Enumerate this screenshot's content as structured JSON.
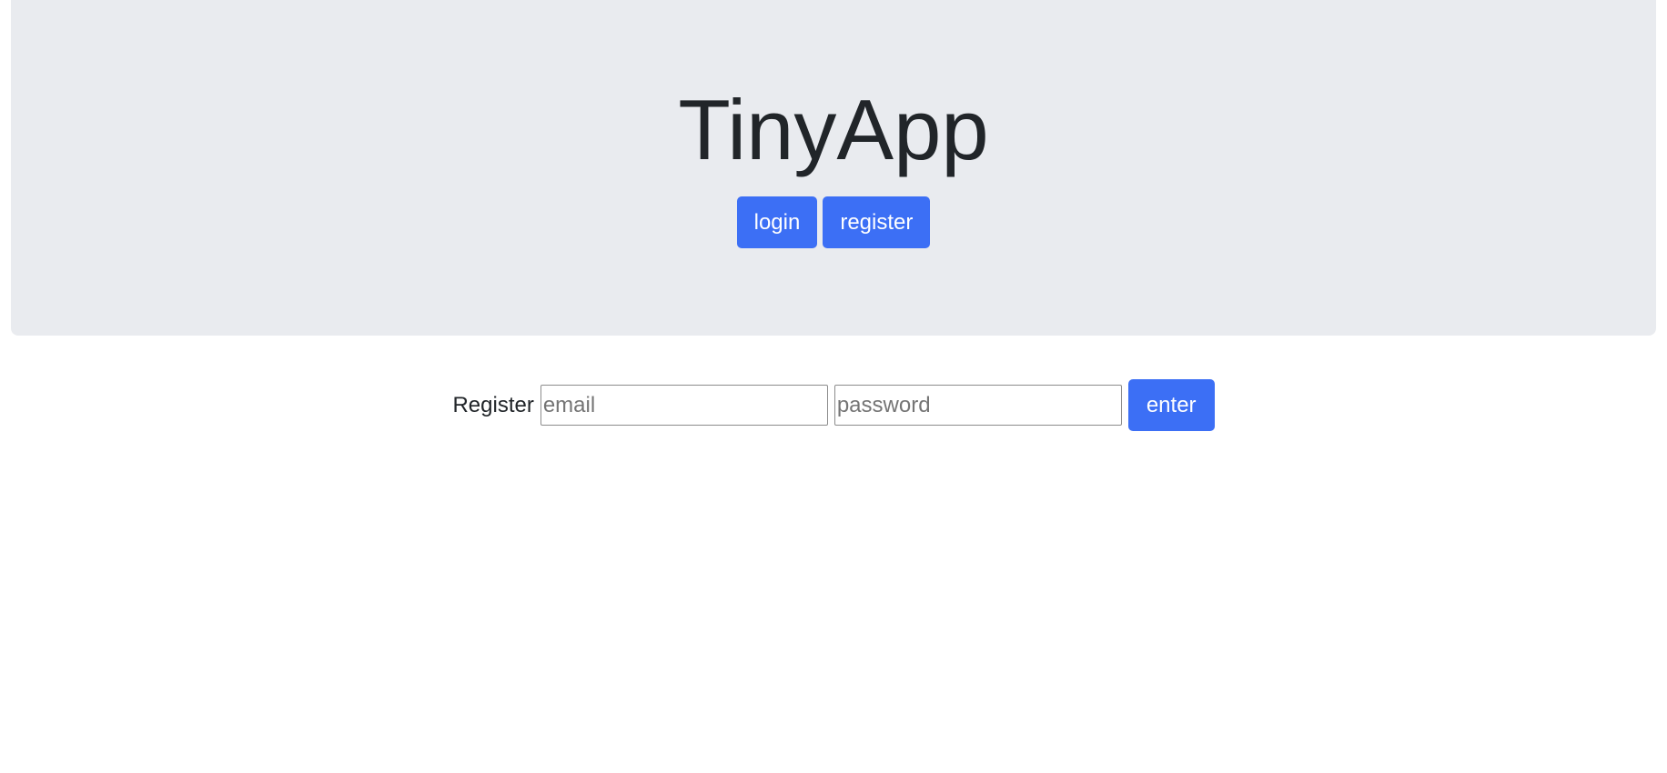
{
  "header": {
    "title": "TinyApp",
    "login_label": "login",
    "register_label": "register"
  },
  "register_form": {
    "label": "Register",
    "email": {
      "value": "",
      "placeholder": "email"
    },
    "password": {
      "value": "",
      "placeholder": "password"
    },
    "submit_label": "enter"
  },
  "colors": {
    "jumbotron_bg": "#e9ebef",
    "primary": "#3c6ff5",
    "text": "#212529"
  }
}
